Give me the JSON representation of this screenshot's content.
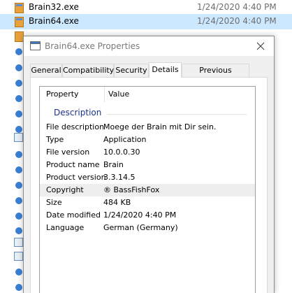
{
  "explorer": {
    "files": [
      {
        "name": "Brain32.exe",
        "date": "1/24/2020 4:40 PM"
      },
      {
        "name": "Brain64.exe",
        "date": "1/24/2020 4:40 PM"
      }
    ]
  },
  "dialog": {
    "title": "Brain64.exe Properties",
    "close_icon": "close-icon",
    "tabs": [
      {
        "label": "General"
      },
      {
        "label": "Compatibility"
      },
      {
        "label": "Security"
      },
      {
        "label": "Details"
      },
      {
        "label": "Previous Versions"
      }
    ],
    "active_tab": "Details",
    "details": {
      "col_property": "Property",
      "col_value": "Value",
      "group": "Description",
      "rows": [
        {
          "key": "File description",
          "value": "Moege der Brain mit Dir sein."
        },
        {
          "key": "Type",
          "value": "Application"
        },
        {
          "key": "File version",
          "value": "10.0.0.30"
        },
        {
          "key": "Product name",
          "value": "Brain"
        },
        {
          "key": "Product version",
          "value": "3.3.14.5"
        },
        {
          "key": "Copyright",
          "value": "® BassFishFox"
        },
        {
          "key": "Size",
          "value": "484 KB"
        },
        {
          "key": "Date modified",
          "value": "1/24/2020 4:40 PM"
        },
        {
          "key": "Language",
          "value": "German (Germany)"
        }
      ]
    }
  },
  "colors": {
    "selection": "#cce8ff",
    "group_label": "#1e3287",
    "sidebar_icon": "#3b7fd4"
  }
}
